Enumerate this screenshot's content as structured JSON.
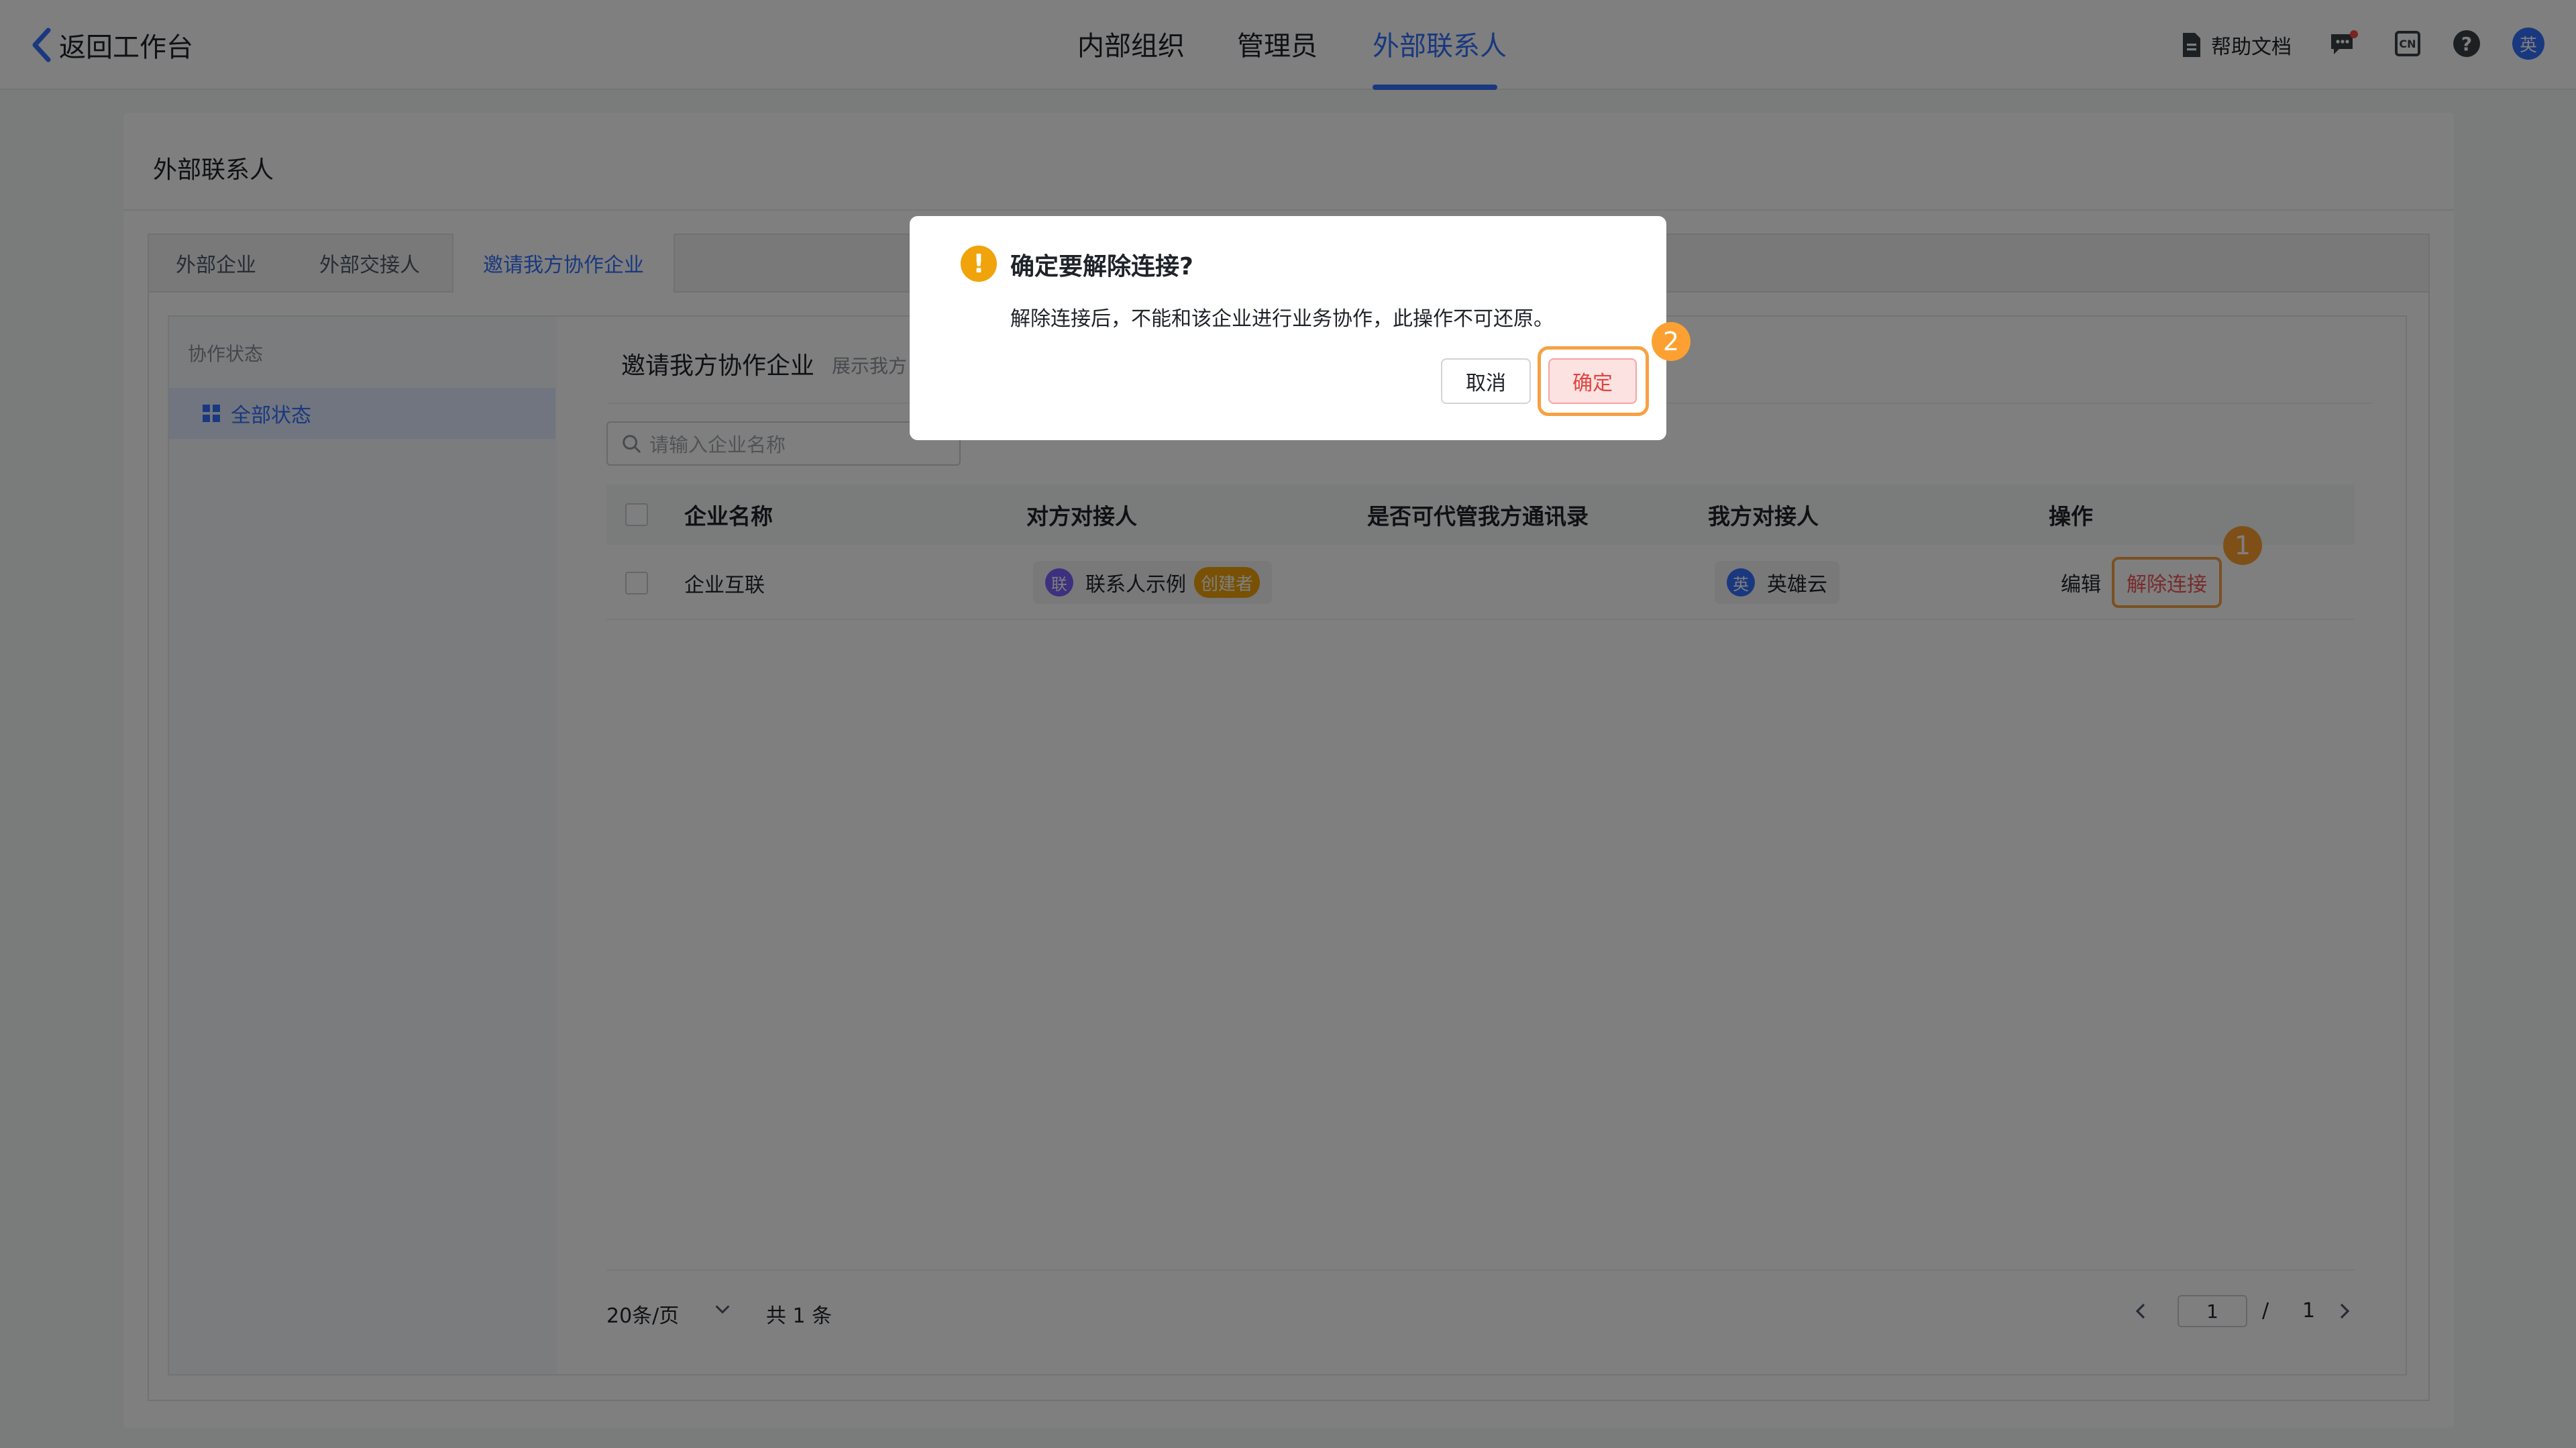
{
  "topbar": {
    "back_label": "返回工作台",
    "nav_tabs": [
      "内部组织",
      "管理员",
      "外部联系人"
    ],
    "active_tab": "外部联系人",
    "help_label": "帮助文档",
    "lang_label": "CN",
    "help_icon_label": "?",
    "user_avatar": "英"
  },
  "page": {
    "title": "外部联系人",
    "tabs": [
      "外部企业",
      "外部交接人",
      "邀请我方协作企业"
    ],
    "active_tab": "邀请我方协作企业",
    "sidebar": {
      "heading": "协作状态",
      "items": [
        {
          "label": "全部状态",
          "active": true
        }
      ]
    },
    "section": {
      "title": "邀请我方协作企业",
      "desc": "展示我方"
    },
    "search": {
      "placeholder": "请输入企业名称"
    },
    "table": {
      "columns": [
        "企业名称",
        "对方对接人",
        "是否可代管我方通讯录",
        "我方对接人",
        "操作"
      ],
      "rows": [
        {
          "company": "企业互联",
          "their_contact": {
            "avatar": "联",
            "name": "联系人示例",
            "badge": "创建者"
          },
          "can_manage": "",
          "our_contact": {
            "avatar": "英",
            "name": "英雄云"
          },
          "actions": {
            "edit": "编辑",
            "unlink": "解除连接"
          }
        }
      ]
    },
    "pagination": {
      "page_size": "20条/页",
      "total": "共 1 条",
      "current": "1",
      "separator": "/",
      "pages": "1"
    }
  },
  "modal": {
    "title": "确定要解除连接?",
    "body": "解除连接后，不能和该企业进行业务协作，此操作不可还原。",
    "cancel": "取消",
    "confirm": "确定",
    "warn_symbol": "!"
  },
  "annotations": {
    "step1": "1",
    "step2": "2"
  },
  "colors": {
    "primary": "#3370ff",
    "warning": "#f0a30a",
    "danger": "#f05757",
    "highlight": "#f7a142"
  },
  "icons": [
    "chevron-left-icon",
    "document-icon",
    "chat-icon",
    "language-icon",
    "help-icon",
    "grid-icon",
    "search-icon",
    "chevron-down-icon",
    "chevron-left-icon",
    "chevron-right-icon",
    "warning-icon"
  ]
}
